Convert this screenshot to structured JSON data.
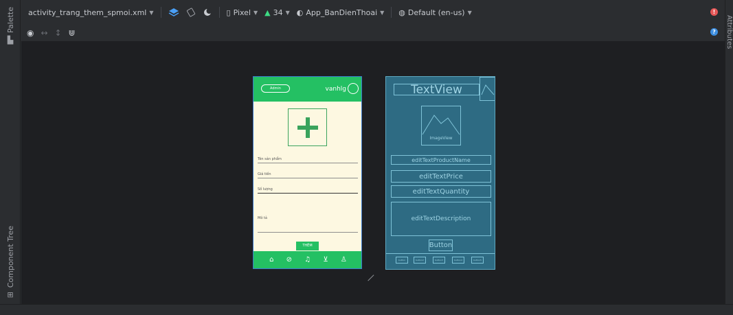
{
  "toolbar": {
    "file": "activity_trang_them_spmoi.xml",
    "device": "Pixel",
    "api": "34",
    "theme": "App_BanDienThoai",
    "locale": "Default (en-us)"
  },
  "side_tabs": {
    "palette": "Palette",
    "component_tree": "Component Tree",
    "attributes": "Attributes"
  },
  "phone": {
    "admin": "Admin",
    "username": "vanhlg",
    "fields": [
      "Tên sản phẩm",
      "Giá tiền",
      "Số lượng",
      "Mô tả"
    ],
    "add_button": "THÊM",
    "nav_icons": [
      "home-icon",
      "tag-icon",
      "bell-icon",
      "cart-icon",
      "user-icon"
    ]
  },
  "blueprint": {
    "top_text": "TextView",
    "image_label": "ImageView",
    "fields": [
      "editTextProductName",
      "editTextPrice",
      "editTextQuantity",
      "editTextDescription"
    ],
    "button": "Button",
    "nav_buttons": [
      "button",
      "button2",
      "button3",
      "button4",
      "button5"
    ]
  },
  "colors": {
    "accent": "#24c063",
    "blueprint": "#2e6b83",
    "background": "#1e1f22"
  }
}
